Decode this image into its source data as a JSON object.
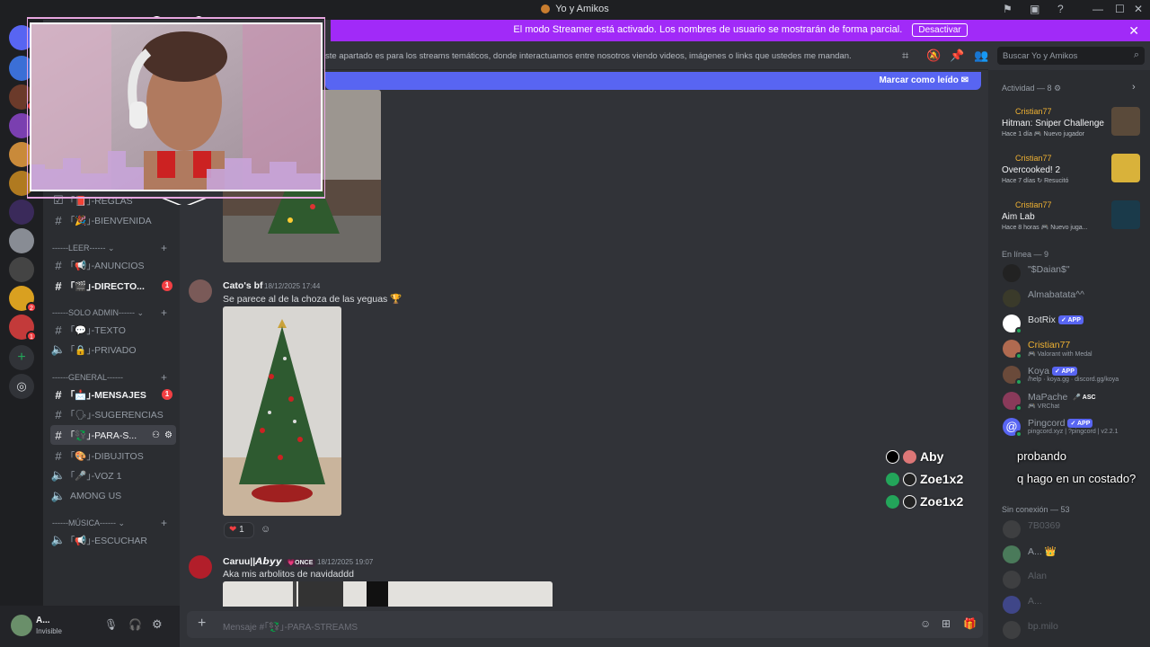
{
  "window": {
    "title": "Yo y Amikos"
  },
  "banner": {
    "text": "El modo Streamer está activado. Los nombres de usuario se mostrarán de forma parcial.",
    "button": "Desactivar"
  },
  "header": {
    "topic": "ste apartado es para los streams temáticos, donde interactuamos entre nosotros viendo videos, imágenes o links que ustedes me mandan.",
    "search_placeholder": "Buscar Yo y Amikos"
  },
  "newbar": {
    "mark_read": "Marcar como leído"
  },
  "server_rail": {
    "badges": [
      "2",
      "2",
      "1"
    ]
  },
  "channels": {
    "reglas": "｢📕｣-REGLAS",
    "bienvenida": "｢🎉｣-BIENVENIDA",
    "cat_leer": "------LEER------",
    "anuncios": "｢📢｣-ANUNCIOS",
    "directo": "｢🎬｣-DIRECTO...",
    "directo_badge": "1",
    "cat_admin": "------SOLO ADMIN------",
    "texto": "｢💬｣-TEXTO",
    "privado": "｢🔒｣-PRIVADO",
    "cat_general": "------GENERAL------",
    "mensajes": "｢📩｣-MENSAJES",
    "mensajes_badge": "1",
    "sugerencias": "｢🗣｣-SUGERENCIAS",
    "para_streams": "｢💱｣-PARA-S...",
    "dibujitos": "｢🎨｣-DIBUJITOS",
    "voz": "｢🎤｣-VOZ 1",
    "among": "AMONG US",
    "cat_musica": "------MÚSICA------",
    "escuchar": "｢📢｣-ESCUCHAR"
  },
  "user_panel": {
    "name": "A...",
    "status": "Invisible"
  },
  "messages": [
    {
      "author": "Cato's bf",
      "timestamp": "18/12/2025 17:44",
      "text": "Se parece al de la choza de las yeguas 🏆",
      "reaction_emoji": "❤",
      "reaction_count": "1"
    },
    {
      "author": "Caruu||𝘼𝙗𝙮𝙮",
      "tag": "💗ONCE",
      "timestamp": "18/12/2025 19:07",
      "text": "Aka mis arbolitos de navidaddd"
    }
  ],
  "composer": {
    "placeholder": "Mensaje #｢💱｣-PARA-STREAMS"
  },
  "activity": {
    "header": "Actividad — 8",
    "items": [
      {
        "user": "Cristian77",
        "game": "Hitman: Sniper Challenge",
        "meta": "Hace 1 día   🎮 Nuevo jugador"
      },
      {
        "user": "Cristian77",
        "game": "Overcooked! 2",
        "meta": "Hace 7 días   ↻ Resucitó"
      },
      {
        "user": "Cristian77",
        "game": "Aim Lab",
        "meta": "Hace 8 horas   🎮 Nuevo juga..."
      }
    ]
  },
  "members": {
    "online_header": "En línea — 9",
    "online": [
      {
        "name": "\"$Daian$\"",
        "sub": "",
        "app": ""
      },
      {
        "name": "Almabatata^^",
        "sub": "",
        "app": ""
      },
      {
        "name": "BotRix",
        "sub": "",
        "app": "✓ APP"
      },
      {
        "name": "Cristian77",
        "sub": "🎮 Valorant with Medal",
        "app": ""
      },
      {
        "name": "Koya",
        "sub": "/help · koya.gg · discord.gg/koya",
        "app": "✓ APP"
      },
      {
        "name": "MaPache",
        "sub": "🎮 VRChat",
        "app": "🎤 ASC"
      },
      {
        "name": "Pingcord",
        "sub": "pingcord.xyz | ?pingcord | v2.2.1",
        "app": "✓ APP"
      }
    ],
    "offline_header": "Sin conexión — 53",
    "offline": [
      {
        "name": "7B0369"
      },
      {
        "name": "A... 👑"
      },
      {
        "name": "Alan"
      },
      {
        "name": "A..."
      },
      {
        "name": "bp.milo"
      }
    ]
  },
  "overlay": {
    "viewers": [
      {
        "name": "Aby"
      },
      {
        "name": "Zoe1x2"
      },
      {
        "name": "Zoe1x2"
      }
    ],
    "chat": [
      {
        "text": "probando"
      },
      {
        "text": "q hago en un costado?"
      }
    ]
  },
  "colors": {
    "banner": "#a12af8",
    "accent": "#5865f2",
    "mention": "#f23f43",
    "gold": "#f0b232"
  }
}
